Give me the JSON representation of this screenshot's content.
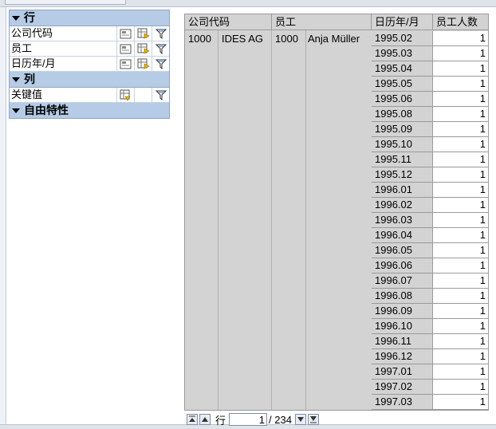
{
  "navigation": {
    "rows_section": {
      "title": "行",
      "items": [
        {
          "label": "公司代码"
        },
        {
          "label": "员工"
        },
        {
          "label": "日历年/月"
        }
      ]
    },
    "columns_section": {
      "title": "列",
      "items": [
        {
          "label": "关键值"
        }
      ]
    },
    "free_section": {
      "title": "自由特性"
    }
  },
  "table": {
    "headers": {
      "company_code": "公司代码",
      "employee": "员工",
      "calendar_month": "日历年/月",
      "headcount": "员工人数"
    },
    "company_id": "1000",
    "company_name": "IDES AG",
    "employee_id": "1000",
    "employee_name": "Anja Müller",
    "rows": [
      {
        "month": "1995.02",
        "value": "1"
      },
      {
        "month": "1995.03",
        "value": "1"
      },
      {
        "month": "1995.04",
        "value": "1"
      },
      {
        "month": "1995.05",
        "value": "1"
      },
      {
        "month": "1995.06",
        "value": "1"
      },
      {
        "month": "1995.08",
        "value": "1"
      },
      {
        "month": "1995.09",
        "value": "1"
      },
      {
        "month": "1995.10",
        "value": "1"
      },
      {
        "month": "1995.11",
        "value": "1"
      },
      {
        "month": "1995.12",
        "value": "1"
      },
      {
        "month": "1996.01",
        "value": "1"
      },
      {
        "month": "1996.02",
        "value": "1"
      },
      {
        "month": "1996.03",
        "value": "1"
      },
      {
        "month": "1996.04",
        "value": "1"
      },
      {
        "month": "1996.05",
        "value": "1"
      },
      {
        "month": "1996.06",
        "value": "1"
      },
      {
        "month": "1996.07",
        "value": "1"
      },
      {
        "month": "1996.08",
        "value": "1"
      },
      {
        "month": "1996.09",
        "value": "1"
      },
      {
        "month": "1996.10",
        "value": "1"
      },
      {
        "month": "1996.11",
        "value": "1"
      },
      {
        "month": "1996.12",
        "value": "1"
      },
      {
        "month": "1997.01",
        "value": "1"
      },
      {
        "month": "1997.02",
        "value": "1"
      },
      {
        "month": "1997.03",
        "value": "1"
      }
    ]
  },
  "pager": {
    "row_label": "行",
    "current": "1",
    "total": "/ 234"
  }
}
